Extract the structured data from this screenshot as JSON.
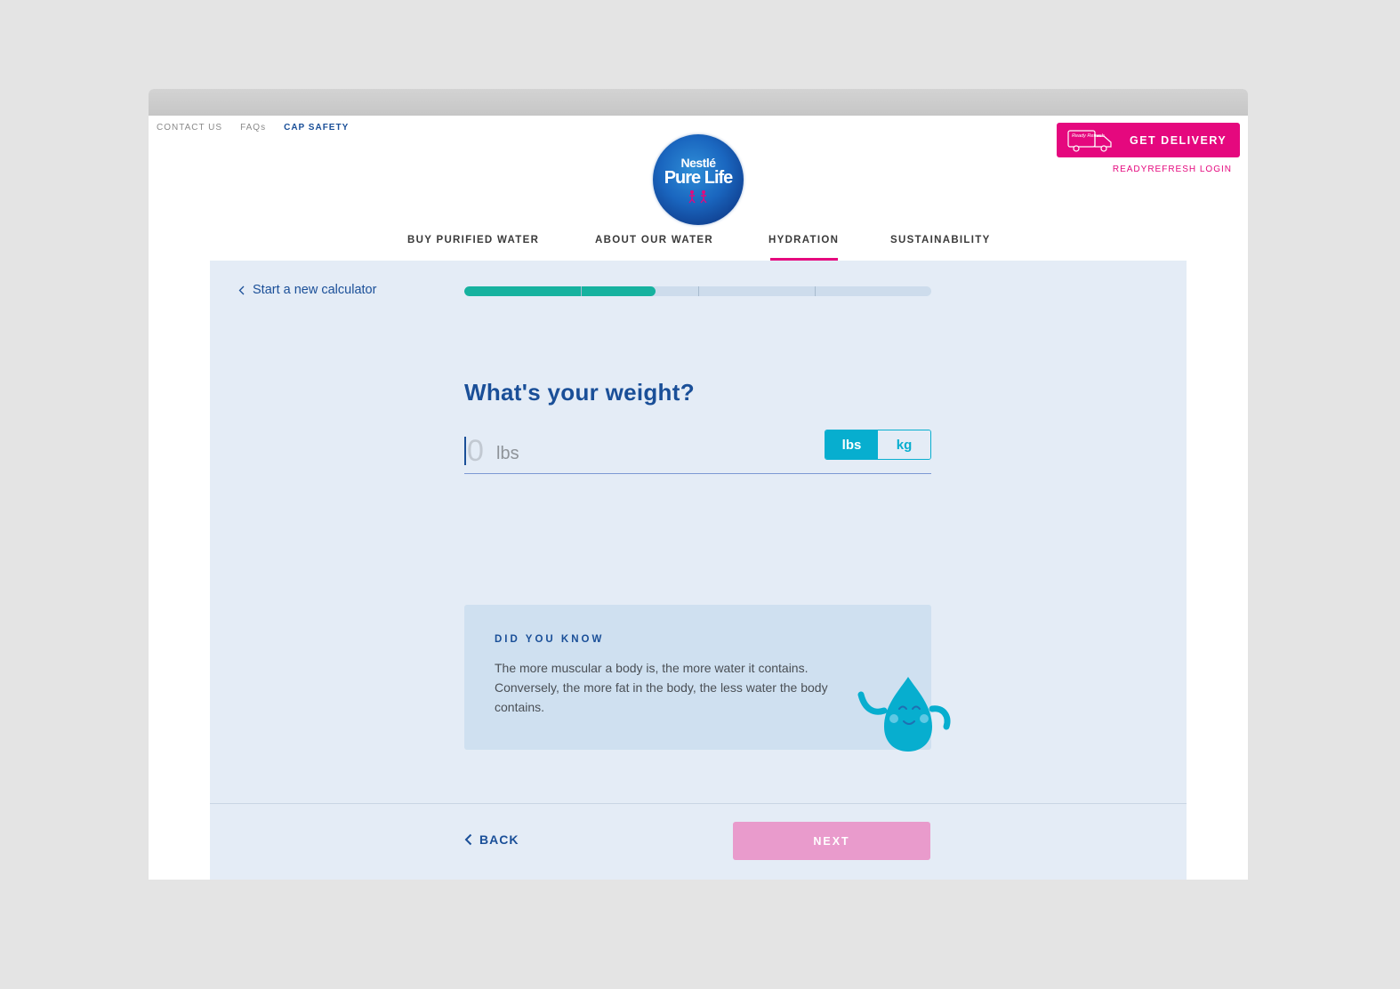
{
  "topbar": {
    "links": [
      {
        "label": "CONTACT US"
      },
      {
        "label": "FAQs"
      },
      {
        "label": "CAP SAFETY"
      }
    ],
    "delivery_button": "GET DELIVERY",
    "delivery_icon_text": "Ready Refresh",
    "login_link": "READYREFRESH LOGIN"
  },
  "logo": {
    "line1": "Nestlé",
    "line2": "Pure Life"
  },
  "nav": {
    "items": [
      {
        "label": "BUY PURIFIED WATER"
      },
      {
        "label": "ABOUT OUR WATER"
      },
      {
        "label": "HYDRATION",
        "active": true
      },
      {
        "label": "SUSTAINABILITY"
      }
    ]
  },
  "calculator": {
    "new_calc_link": "Start a new calculator",
    "progress": {
      "value": 0.41,
      "steps": 4
    },
    "question": "What's your weight?",
    "weight_input": {
      "placeholder": "0",
      "value": ""
    },
    "unit_label": "lbs",
    "unit_options": [
      {
        "label": "lbs",
        "selected": true
      },
      {
        "label": "kg",
        "selected": false
      }
    ],
    "did_you_know": {
      "title": "DID YOU KNOW",
      "text": "The more muscular a body is, the more water it contains. Conversely, the more fat in the body, the less water the body contains."
    },
    "back_button": "BACK",
    "next_button": "NEXT"
  },
  "colors": {
    "brand_blue": "#1a4f98",
    "brand_pink": "#e5087e",
    "progress_fill": "#16b29f",
    "accent_cyan": "#07aecf",
    "panel_bg": "#e4ecf6"
  }
}
